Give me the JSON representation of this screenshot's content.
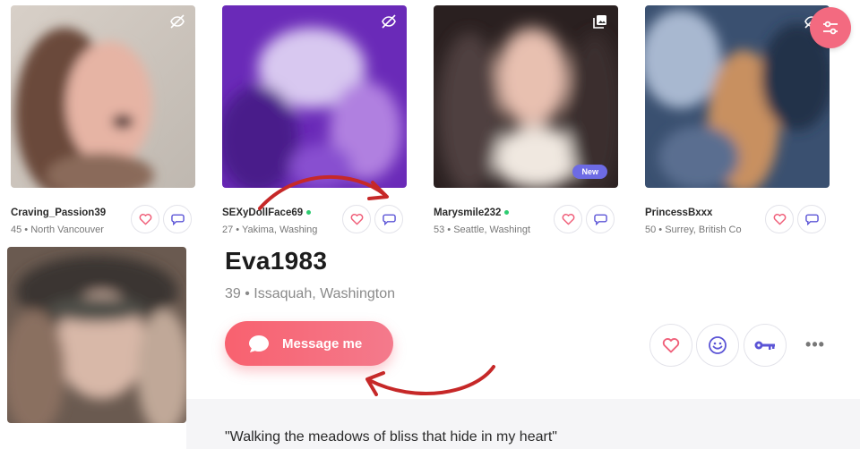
{
  "grid": {
    "cards": [
      {
        "username": "Craving_Passion39",
        "meta": "45 • North Vancouver",
        "online": false,
        "new": false,
        "corner_icon": "hidden-photo-icon",
        "palette": [
          "#6b4a3a",
          "#e6b4a4",
          "#8a6a5a",
          "#d8d0c8"
        ]
      },
      {
        "username": "SEXyDollFace69",
        "meta": "27 • Yakima, Washing",
        "online": true,
        "new": false,
        "corner_icon": "hidden-photo-icon",
        "palette": [
          "#6a2ab8",
          "#d8c8f0",
          "#4a1a8a",
          "#b080e0"
        ]
      },
      {
        "username": "Marysmile232",
        "meta": "53 • Seattle, Washingt",
        "online": true,
        "new": true,
        "corner_icon": "gallery-icon",
        "palette": [
          "#2a2020",
          "#e8c0b0",
          "#504040",
          "#f0e8e0"
        ]
      },
      {
        "username": "PrincessBxxx",
        "meta": "50 • Surrey, British Co",
        "online": false,
        "new": false,
        "corner_icon": "hidden-photo-icon",
        "palette": [
          "#3a5070",
          "#c89060",
          "#20304a",
          "#a8b8d0"
        ]
      }
    ],
    "new_badge": "New"
  },
  "profile": {
    "username": "Eva1983",
    "meta": "39 • Issaquah, Washington",
    "message_label": "Message me",
    "quote": "\"Walking the meadows of bliss that hide in my heart\""
  },
  "colors": {
    "accent": "#f8616f",
    "icon_purple": "#5b54d6",
    "badge": "#6d6be4",
    "annotation": "#c62828"
  }
}
